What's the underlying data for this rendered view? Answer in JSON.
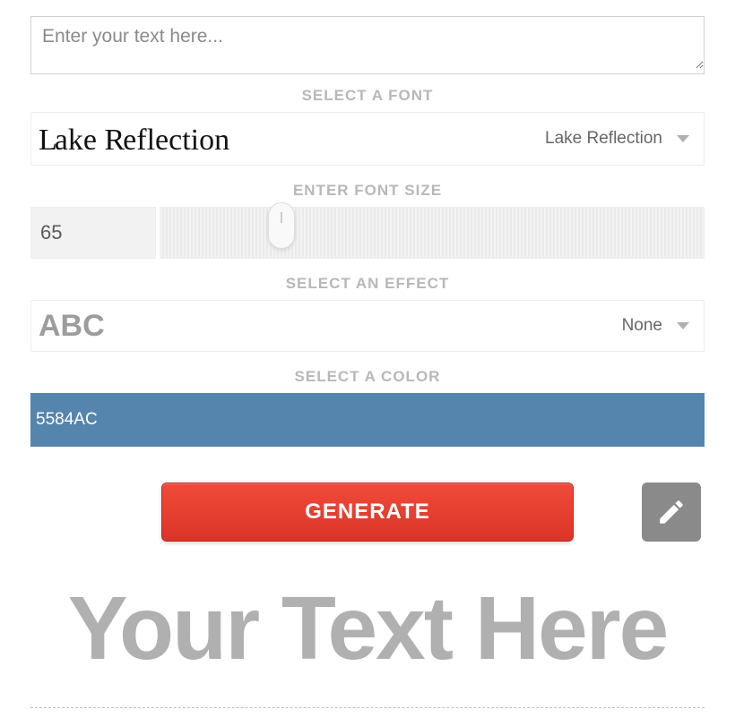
{
  "text_input": {
    "value": "",
    "placeholder": "Enter your text here..."
  },
  "sections": {
    "font_label": "SELECT A FONT",
    "size_label": "ENTER FONT SIZE",
    "effect_label": "SELECT AN EFFECT",
    "color_label": "SELECT A COLOR"
  },
  "font": {
    "preview_text": "Lake Reflection",
    "selected": "Lake Reflection"
  },
  "font_size": {
    "value": "65"
  },
  "effect": {
    "preview_text": "ABC",
    "selected": "None"
  },
  "color": {
    "value": "5584AC",
    "hex": "#5584AC"
  },
  "buttons": {
    "generate": "GENERATE"
  },
  "preview": {
    "text": "Your Text Here"
  }
}
